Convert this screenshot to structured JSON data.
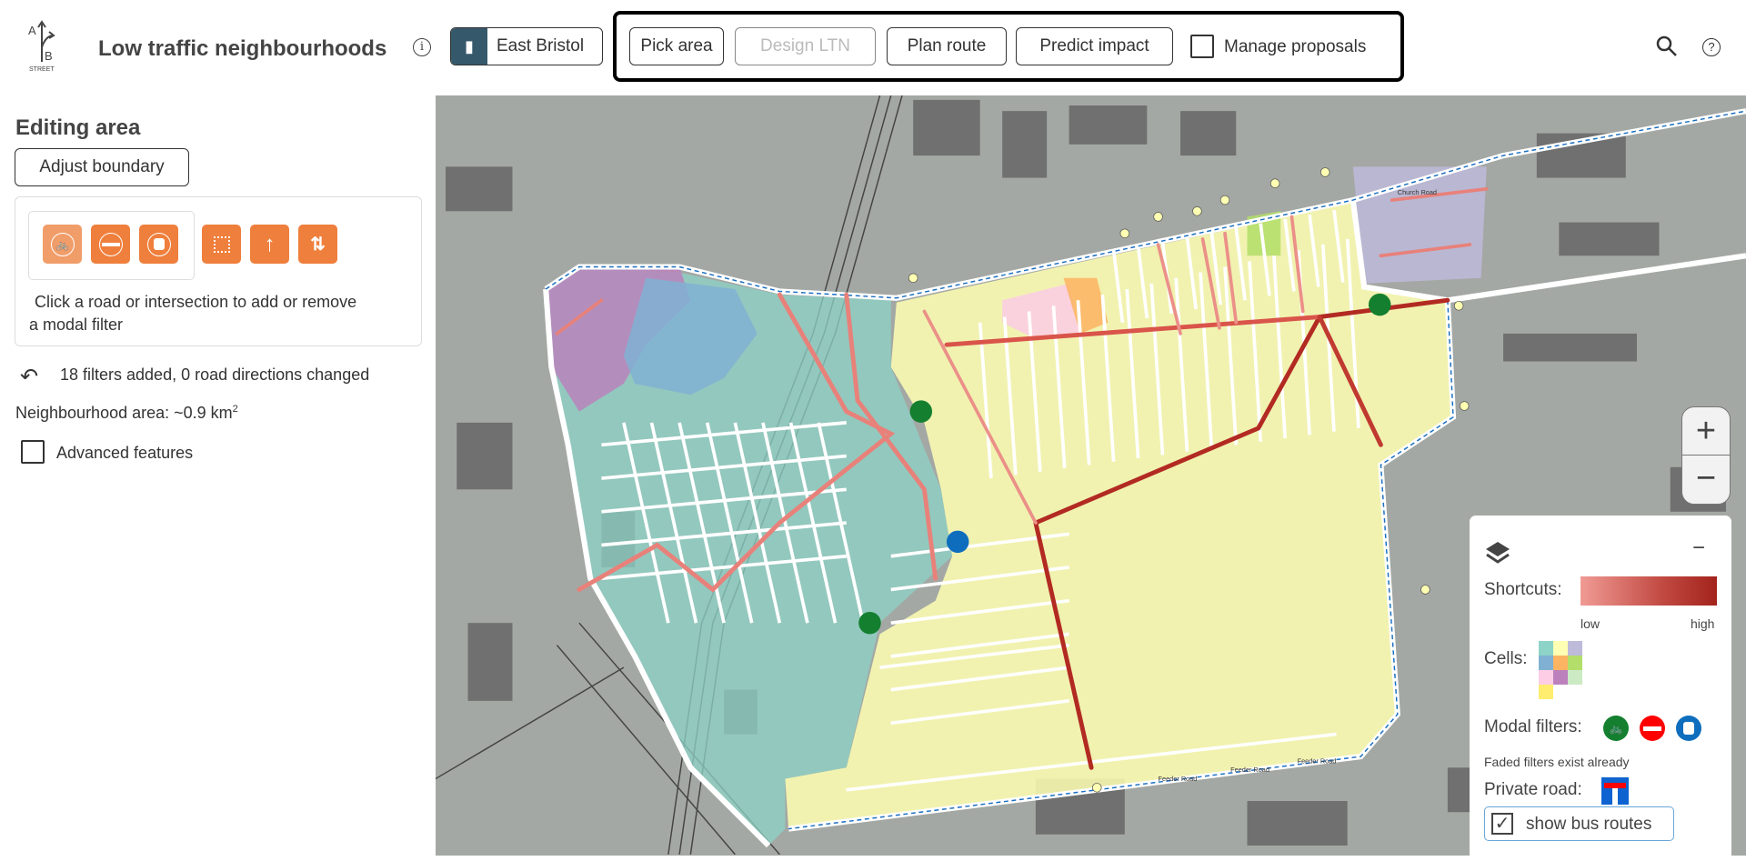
{
  "header": {
    "logo_text": "A B STREET",
    "title": "Low traffic neighbourhoods",
    "area_button": "East Bristol",
    "nav": [
      {
        "label": "Pick area",
        "enabled": true
      },
      {
        "label": "Design LTN",
        "enabled": false
      },
      {
        "label": "Plan route",
        "enabled": true
      },
      {
        "label": "Predict impact",
        "enabled": true
      }
    ],
    "manage_proposals": {
      "label": "Manage proposals",
      "checked": false
    }
  },
  "sidebar": {
    "heading": "Editing area",
    "adjust_boundary": "Adjust boundary",
    "tools": [
      "walk-cycle-filter-icon",
      "no-entry-filter-icon",
      "bus-gate-filter-icon",
      "select-area-icon",
      "one-way-arrow-icon",
      "swap-direction-icon"
    ],
    "instruction": "Click a road or intersection to add or remove a modal filter",
    "undo_status": "18 filters added, 0 road directions changed",
    "area_label": "Neighbourhood area: ~0.9 km",
    "area_sup": "2",
    "advanced": {
      "label": "Advanced features",
      "checked": false
    }
  },
  "map": {
    "zoom_in": "+",
    "zoom_out": "−",
    "road_labels": [
      "Feeder Road",
      "Feeder Road",
      "Feeder Road",
      "Church Road"
    ]
  },
  "legend": {
    "collapse": "−",
    "shortcuts_label": "Shortcuts:",
    "low": "low",
    "high": "high",
    "shortcut_colors": [
      "#f09a94",
      "#a3231c"
    ],
    "cells_label": "Cells:",
    "cell_colors": [
      "#8dd3c7",
      "#ffffb3",
      "#bebada",
      "#80b1d3",
      "#fdb462",
      "#b3de69",
      "#fccde5",
      "#bc80bd",
      "#ccebc5",
      "#ffed6f"
    ],
    "modal_filters_label": "Modal filters:",
    "faded_note": "Faded filters exist already",
    "private_road_label": "Private road:",
    "bus_routes": {
      "label": "show bus routes",
      "checked": true
    }
  },
  "colors": {
    "accent": "#ef7f3c",
    "area_button": "#35596b",
    "filter_green": "#137f2f",
    "filter_red": "#ff0000",
    "filter_blue": "#0e6ebd"
  }
}
